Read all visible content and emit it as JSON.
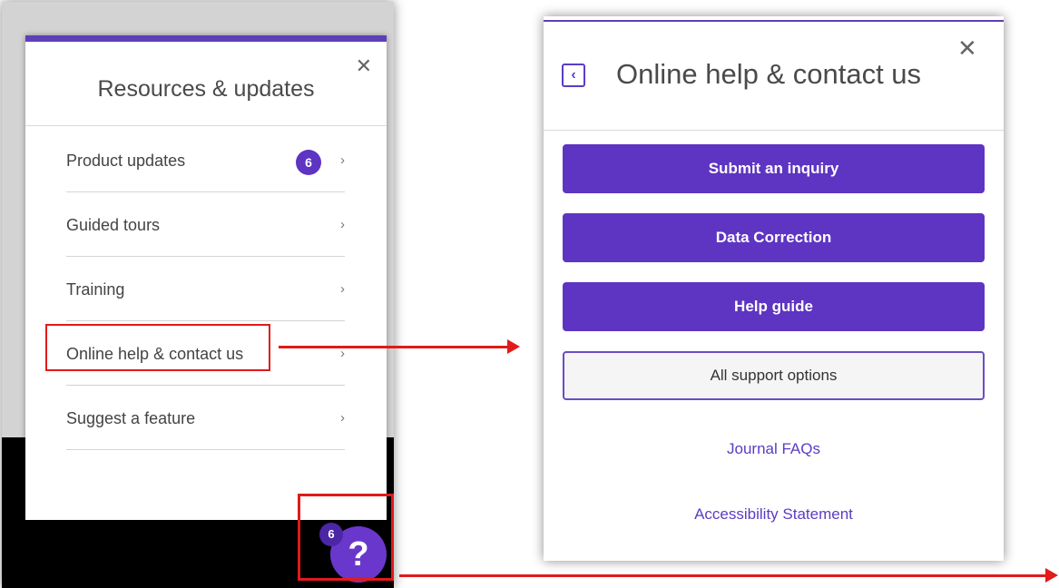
{
  "left_panel": {
    "title": "Resources & updates",
    "close_symbol": "✕",
    "items": [
      {
        "label": "Product updates",
        "badge": "6",
        "chevron": "›"
      },
      {
        "label": "Guided tours",
        "chevron": "›"
      },
      {
        "label": "Training",
        "chevron": "›"
      },
      {
        "label": "Online help & contact us",
        "chevron": "›"
      },
      {
        "label": "Suggest a feature",
        "chevron": "›"
      }
    ],
    "help_button": {
      "symbol": "?",
      "badge": "6"
    }
  },
  "right_panel": {
    "title": "Online help & contact us",
    "back_symbol": "‹",
    "close_symbol": "✕",
    "buttons": [
      {
        "label": "Submit an inquiry"
      },
      {
        "label": "Data Correction"
      },
      {
        "label": "Help guide"
      },
      {
        "label": "All support options"
      }
    ],
    "links": [
      {
        "label": "Journal FAQs"
      },
      {
        "label": "Accessibility Statement"
      }
    ]
  },
  "colors": {
    "accent": "#5e34c2",
    "highlight_red": "#e11a1a"
  }
}
